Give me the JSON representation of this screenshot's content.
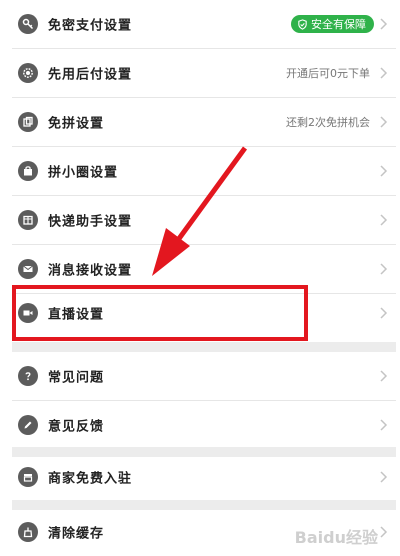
{
  "menu": [
    {
      "key": "password-free",
      "label": "免密支付设置",
      "badge": "安全有保障",
      "icon": "key-icon"
    },
    {
      "key": "pay-later",
      "label": "先用后付设置",
      "value": "开通后可0元下单",
      "icon": "gear-icon"
    },
    {
      "key": "free-group",
      "label": "免拼设置",
      "value": "还剩2次免拼机会",
      "icon": "cards-icon"
    },
    {
      "key": "mini-group",
      "label": "拼小圈设置",
      "icon": "bag-icon"
    },
    {
      "key": "express",
      "label": "快递助手设置",
      "icon": "package-icon"
    },
    {
      "key": "messages",
      "label": "消息接收设置",
      "icon": "message-icon"
    },
    {
      "key": "live",
      "label": "直播设置",
      "icon": "video-icon"
    },
    {
      "key": "faq",
      "label": "常见问题",
      "icon": "question-icon"
    },
    {
      "key": "feedback",
      "label": "意见反馈",
      "icon": "pencil-icon"
    },
    {
      "key": "merchant",
      "label": "商家免费入驻",
      "icon": "shop-icon"
    },
    {
      "key": "clear-cache",
      "label": "清除缓存",
      "icon": "broom-icon"
    }
  ],
  "watermark": "Baidu经验",
  "colors": {
    "highlight": "#e3171f",
    "badge": "#2fb24a"
  }
}
